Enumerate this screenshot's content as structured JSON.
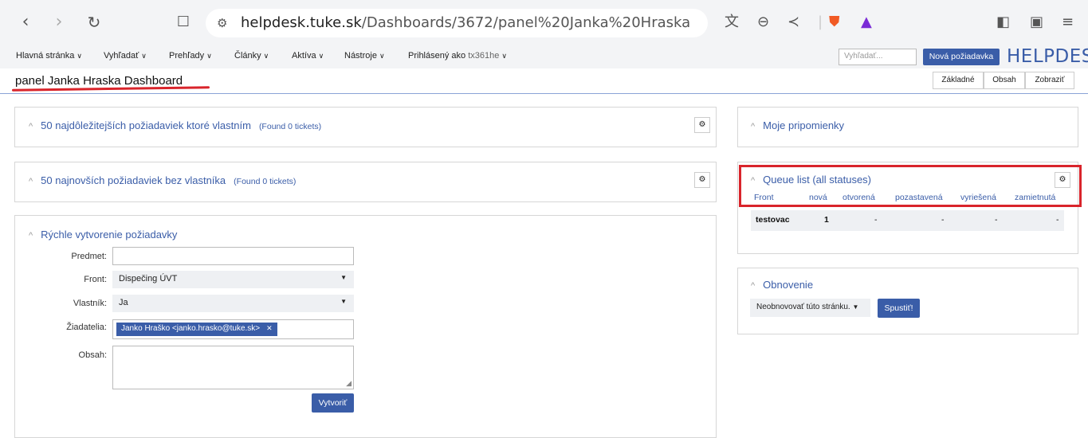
{
  "browser": {
    "url_domain": "helpdesk.tuke.sk",
    "url_path": "/Dashboards/3672/panel%20Janka%20Hraska",
    "icons": [
      "back-icon",
      "forward-icon",
      "reload-icon",
      "bookmark-icon",
      "site-info-icon",
      "translate-icon",
      "zoom-out-icon",
      "share-icon",
      "brave-shield-icon",
      "brave-rewards-icon",
      "sidebar-icon",
      "wallet-icon",
      "menu-icon"
    ]
  },
  "menubar": {
    "items": [
      {
        "label": "Hlavná stránka"
      },
      {
        "label": "Vyhľadať"
      },
      {
        "label": "Prehľady"
      },
      {
        "label": "Články"
      },
      {
        "label": "Aktíva"
      },
      {
        "label": "Nástroje"
      }
    ],
    "logged_in_prefix": "Prihlásený ako",
    "username": "tx361he",
    "search_placeholder": "Vyhľadať...",
    "new_request_label": "Nová požiadavka",
    "logo": "HELPDESK"
  },
  "header": {
    "title": "panel Janka Hraska Dashboard",
    "buttons": [
      "Základné",
      "Obsah",
      "Zobraziť"
    ]
  },
  "panels": {
    "owned": {
      "title": "50 najdôležitejších požiadaviek ktoré vlastním",
      "found": "(Found 0 tickets)"
    },
    "unowned": {
      "title": "50 najnovších požiadaviek bez vlastníka",
      "found": "(Found 0 tickets)"
    },
    "quick_create": {
      "title": "Rýchle vytvorenie požiadavky",
      "subject_label": "Predmet:",
      "queue_label": "Front:",
      "queue_value": "Dispečing ÚVT",
      "owner_label": "Vlastník:",
      "owner_value": "Ja",
      "requestors_label": "Žiadatelia:",
      "requestor_tag": "Janko Hraško <janko.hrasko@tuke.sk>",
      "content_label": "Obsah:",
      "create_label": "Vytvoriť"
    },
    "reminders": {
      "title": "Moje pripomienky"
    },
    "queue_list": {
      "title": "Queue list (all statuses)",
      "columns": [
        "Front",
        "nová",
        "otvorená",
        "pozastavená",
        "vyriešená",
        "zamietnutá"
      ],
      "rows": [
        {
          "queue": "testovac",
          "new": "1",
          "open": "-",
          "stalled": "-",
          "resolved": "-",
          "rejected": "-"
        }
      ]
    },
    "refresh": {
      "title": "Obnovenie",
      "select_value": "Neobnovovať túto stránku.",
      "run_label": "Spustiť!"
    }
  },
  "colors": {
    "accent": "#3a5da8",
    "highlight": "#d9242b"
  }
}
